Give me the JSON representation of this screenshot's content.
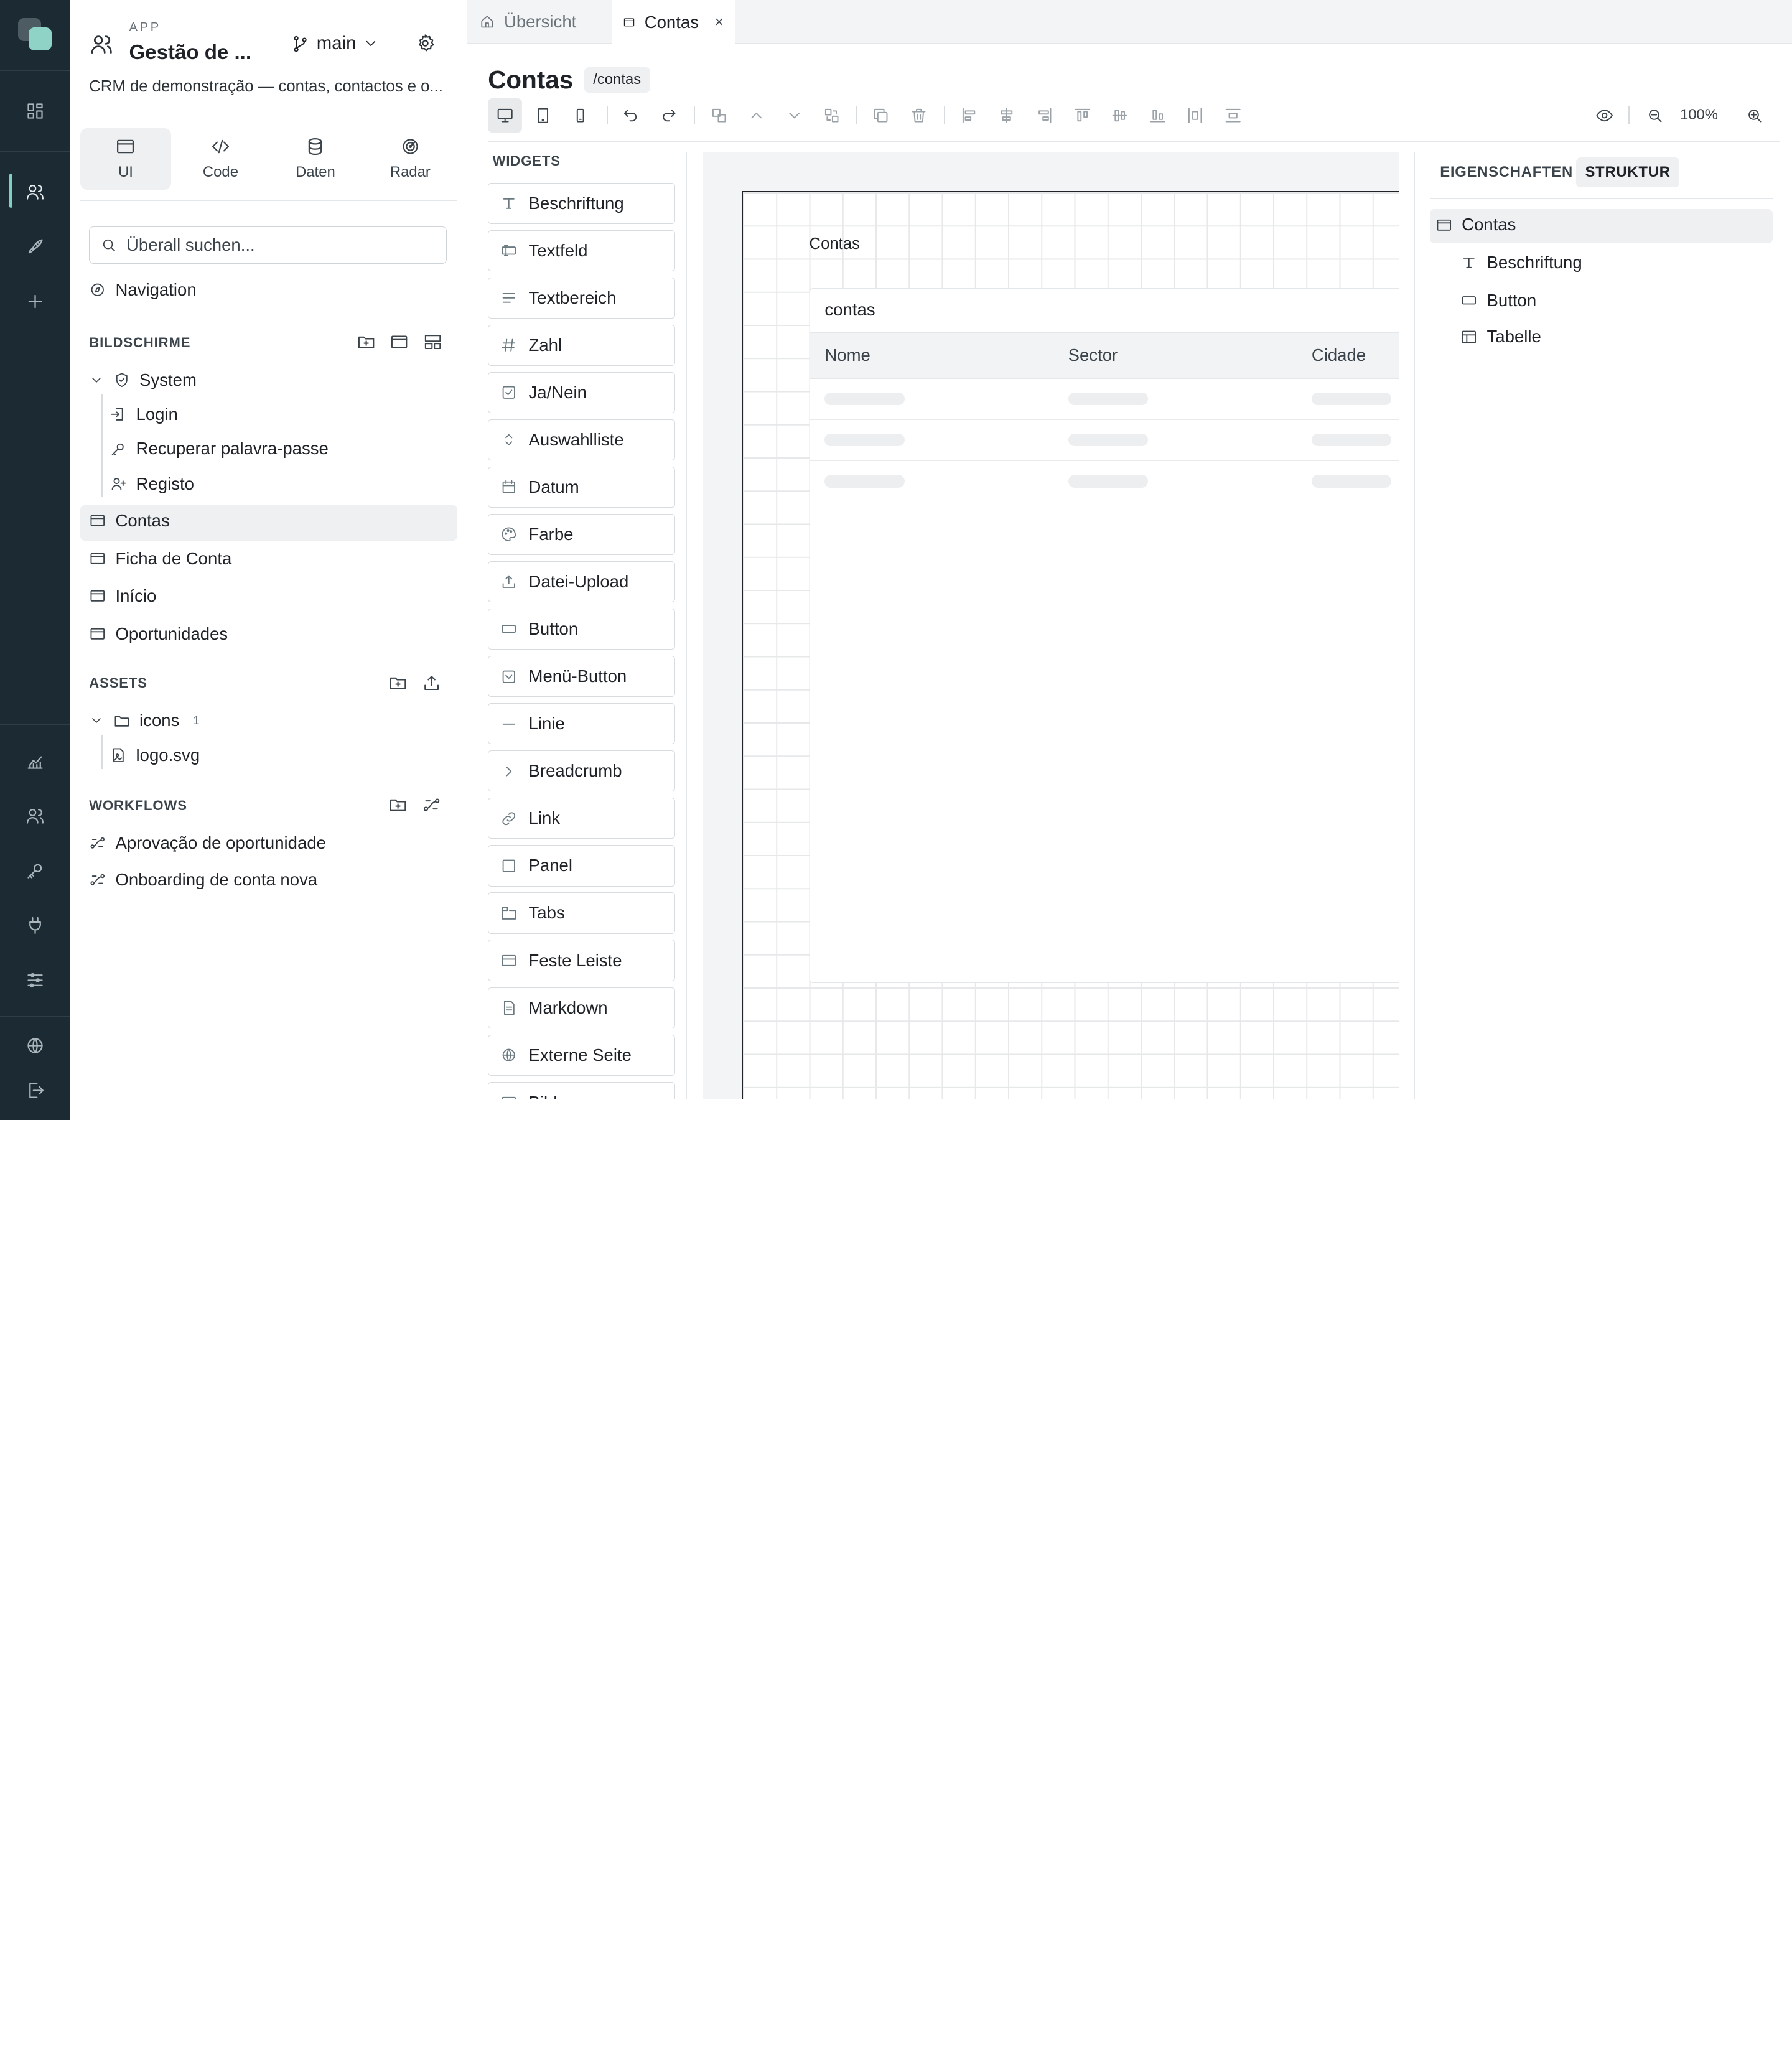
{
  "app": {
    "kicker": "APP",
    "title": "Gestão de ...",
    "branch": "main",
    "description": "CRM de demonstração — contas, contactos e o..."
  },
  "mode_tabs": [
    {
      "label": "UI",
      "icon": "browser-icon"
    },
    {
      "label": "Code",
      "icon": "code-icon"
    },
    {
      "label": "Daten",
      "icon": "database-icon"
    },
    {
      "label": "Radar",
      "icon": "radar-icon"
    }
  ],
  "search": {
    "placeholder": "Überall suchen..."
  },
  "navigation_label": "Navigation",
  "screens": {
    "title": "BILDSCHIRME",
    "group": "System",
    "group_items": [
      "Login",
      "Recuperar palavra-passe",
      "Registo"
    ],
    "items": [
      "Contas",
      "Ficha de Conta",
      "Início",
      "Oportunidades"
    ],
    "selected": "Contas"
  },
  "assets": {
    "title": "ASSETS",
    "folder": "icons",
    "folder_count": "1",
    "file": "logo.svg"
  },
  "workflows": {
    "title": "WORKFLOWS",
    "items": [
      "Aprovação de oportunidade",
      "Onboarding de conta nova"
    ]
  },
  "tabs": [
    {
      "label": "Übersicht",
      "active": false
    },
    {
      "label": "Contas",
      "active": true,
      "close": "×"
    }
  ],
  "page": {
    "title": "Contas",
    "route": "/contas"
  },
  "toolbar": {
    "zoom": "100%"
  },
  "widgets": {
    "title": "WIDGETS",
    "items": [
      {
        "label": "Beschriftung",
        "icon": "text-icon"
      },
      {
        "label": "Textfeld",
        "icon": "textfield-icon"
      },
      {
        "label": "Textbereich",
        "icon": "textarea-icon"
      },
      {
        "label": "Zahl",
        "icon": "hash-icon"
      },
      {
        "label": "Ja/Nein",
        "icon": "checkbox-icon"
      },
      {
        "label": "Auswahlliste",
        "icon": "select-icon"
      },
      {
        "label": "Datum",
        "icon": "calendar-icon"
      },
      {
        "label": "Farbe",
        "icon": "palette-icon"
      },
      {
        "label": "Datei-Upload",
        "icon": "upload-icon"
      },
      {
        "label": "Button",
        "icon": "button-icon"
      },
      {
        "label": "Menü-Button",
        "icon": "menu-button-icon"
      },
      {
        "label": "Linie",
        "icon": "line-icon"
      },
      {
        "label": "Breadcrumb",
        "icon": "chevron-right-icon"
      },
      {
        "label": "Link",
        "icon": "link-icon"
      },
      {
        "label": "Panel",
        "icon": "panel-icon"
      },
      {
        "label": "Tabs",
        "icon": "tabs-icon"
      },
      {
        "label": "Feste Leiste",
        "icon": "fixed-bar-icon"
      },
      {
        "label": "Markdown",
        "icon": "document-icon"
      },
      {
        "label": "Externe Seite",
        "icon": "globe-icon"
      },
      {
        "label": "Bild",
        "icon": "image-icon"
      }
    ]
  },
  "canvas": {
    "label": "Contas",
    "table_title": "contas",
    "columns": [
      "Nome",
      "Sector",
      "Cidade"
    ]
  },
  "right_panel": {
    "tabs": [
      {
        "label": "EIGENSCHAFTEN",
        "active": false
      },
      {
        "label": "STRUKTUR",
        "active": true
      }
    ],
    "root": "Contas",
    "children": [
      {
        "label": "Beschriftung",
        "icon": "text-icon"
      },
      {
        "label": "Button",
        "icon": "button-icon"
      },
      {
        "label": "Tabelle",
        "icon": "table-icon"
      }
    ]
  },
  "colors": {
    "rail": "#1b2a33",
    "accent": "#7fd0c1",
    "selection": "#eef0f2"
  }
}
